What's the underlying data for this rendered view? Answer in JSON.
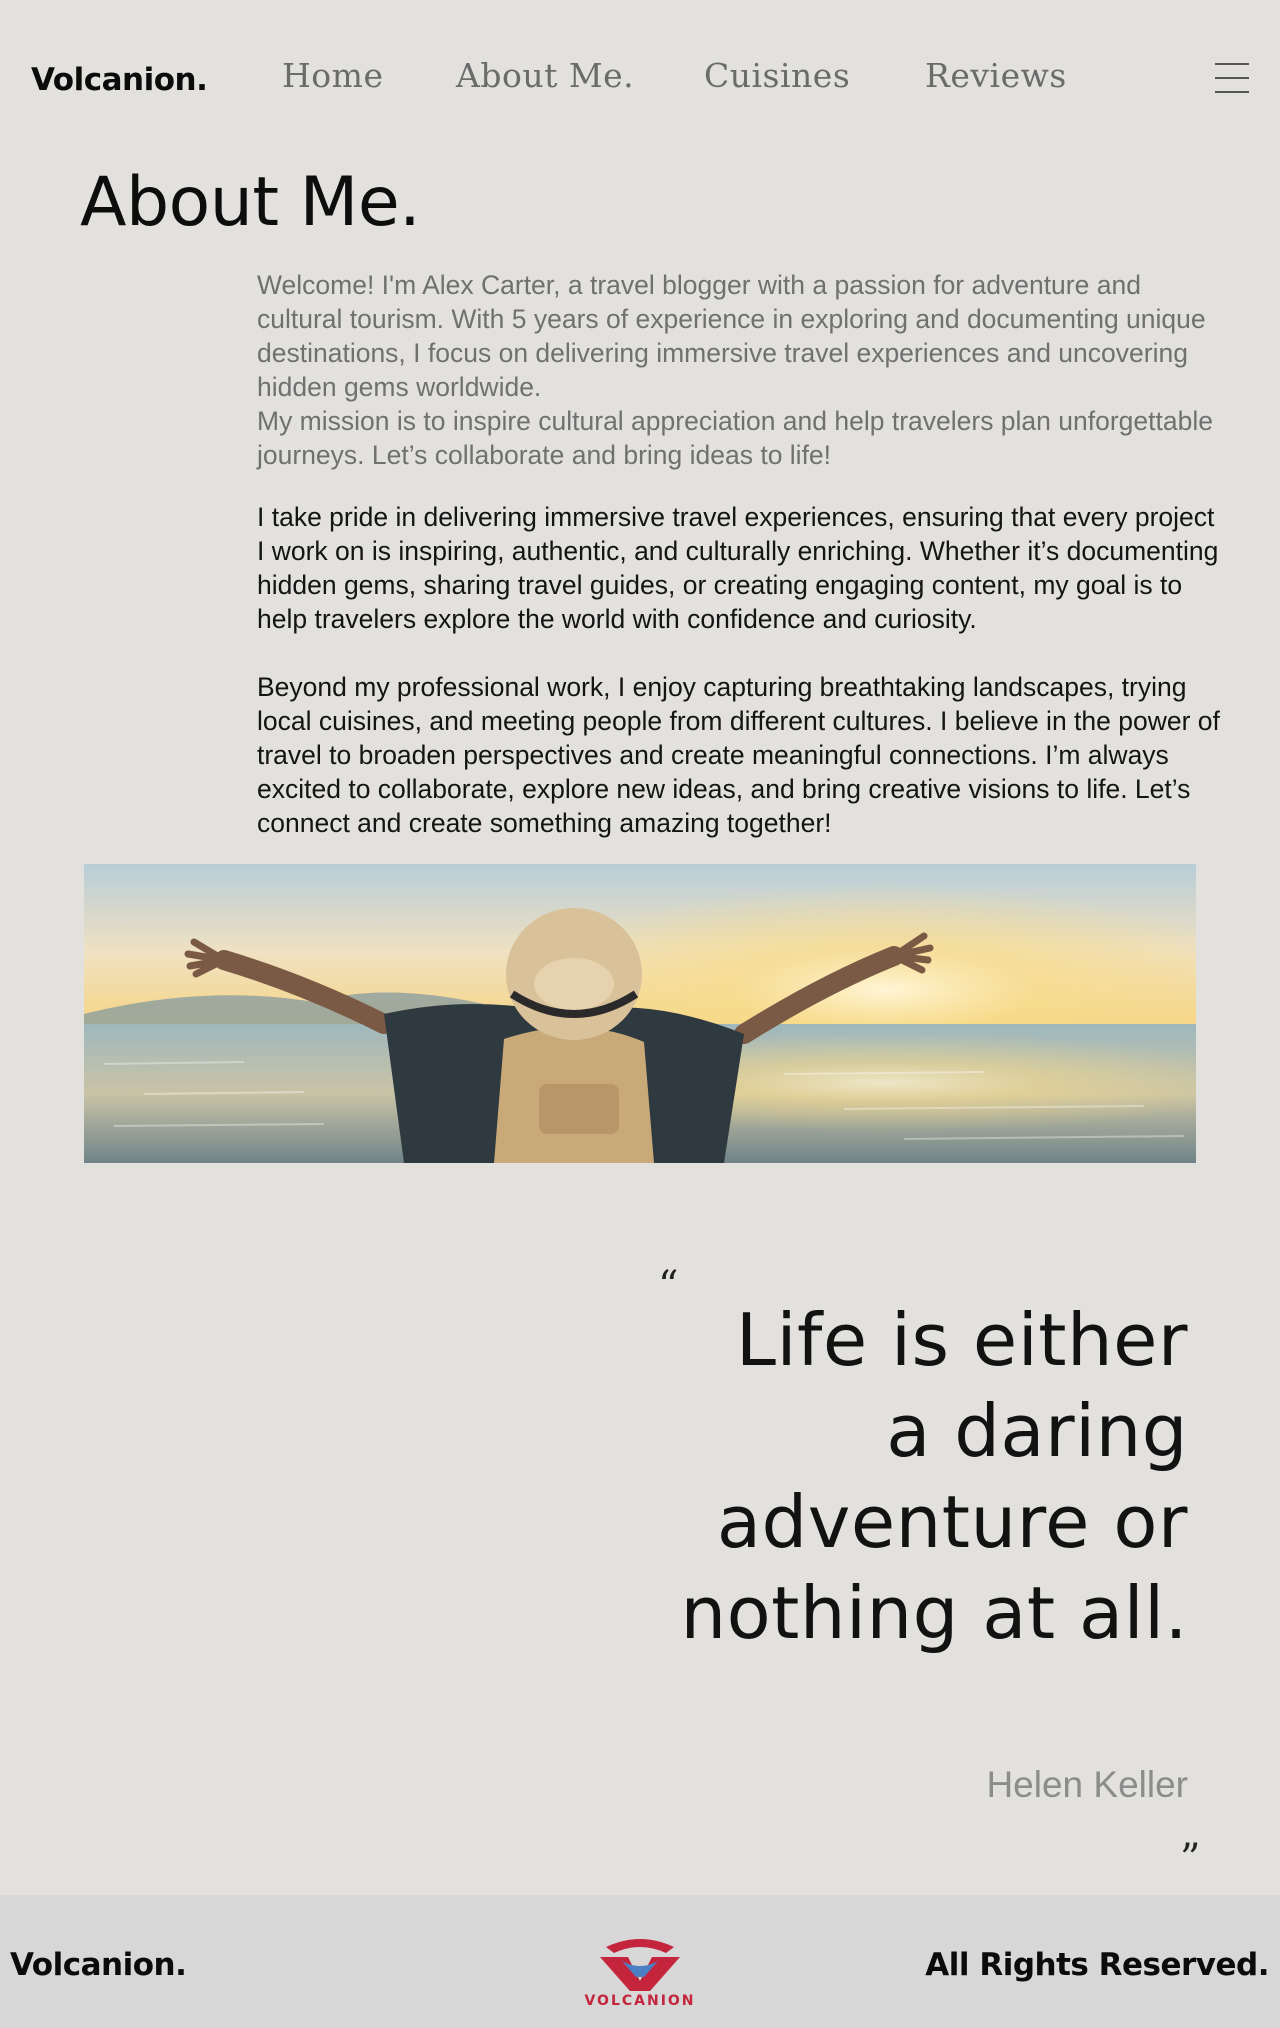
{
  "header": {
    "brand": "Volcanion.",
    "nav": [
      {
        "label": "Home"
      },
      {
        "label": "About Me."
      },
      {
        "label": "Cuisines"
      },
      {
        "label": "Reviews"
      }
    ],
    "menu_icon": "hamburger-menu-icon"
  },
  "about": {
    "title": "About Me.",
    "intro_lines": [
      "Welcome! I'm Alex Carter, a travel blogger with a passion for adventure and cultural tourism. With 5 years of experience in exploring and documenting unique destinations, I focus on delivering immersive travel experiences and uncovering hidden gems worldwide.",
      "My mission is to inspire cultural appreciation and help travelers plan unforgettable journeys. Let’s collaborate and bring ideas to life!"
    ],
    "paragraph2": "I take pride in delivering immersive travel experiences, ensuring that every project I work on is inspiring, authentic, and culturally enriching. Whether it’s documenting hidden gems, sharing travel guides, or creating engaging content, my goal is to help travelers explore the world with confidence and curiosity.",
    "paragraph3": "Beyond my professional work, I enjoy capturing breathtaking landscapes, trying local cuisines, and meeting people from different cultures. I believe in the power of travel to broaden perspectives and create meaningful connections. I’m always excited to collaborate, explore new ideas, and bring creative visions to life. Let’s connect and create something amazing together!"
  },
  "quote": {
    "open_mark": "“",
    "text": "Life is either a daring adventure or nothing at all.",
    "author": "Helen Keller",
    "close_mark": "”"
  },
  "footer": {
    "brand": "Volcanion.",
    "logo_text": "VOLCANION",
    "rights": "All Rights Reserved."
  },
  "colors": {
    "background": "#e3e1de",
    "footer_background": "#d7d7d7",
    "nav_text": "#6b6b6b",
    "intro_text": "#707070",
    "logo_red": "#c4243c"
  }
}
